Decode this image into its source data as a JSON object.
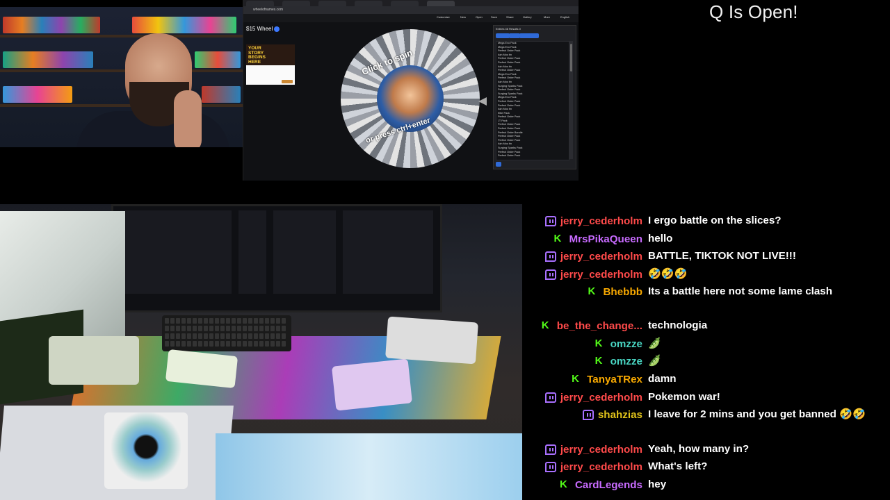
{
  "overlay": {
    "queue_status": "Q Is Open!"
  },
  "browser": {
    "url": "wheelofnames.com",
    "nav": [
      "Customize",
      "New",
      "Open",
      "Save",
      "Share",
      "Gallery",
      "More",
      "English"
    ],
    "wheel_title": "$15 Wheel",
    "ad_title": "YOUR STORY BEGINS HERE",
    "wheel_text_top": "Click to spin",
    "wheel_text_bottom": "or press ctrl+enter",
    "entries_tabs": "Entries 46   Results 0",
    "entries": [
      "Mega Evo Pack",
      "Mega Evo Pack",
      "Perfect Order Pack",
      "Ash Moo  tin",
      "Perfect Order Pack",
      "Perfect Order Pack",
      "Ash Moo  tin",
      "Perfect Order Pack",
      "Mega Evo Pack",
      "Perfect Order Pack",
      "Ash Moo  tin",
      "Surging Sparks Pack",
      "Perfect Order Pack",
      "Surging Sparks Pack",
      "Mega Evo Pack",
      "Perfect Order Pack",
      "Perfect Order Pack",
      "Ash Moo  tin",
      "Elite Pack",
      "Perfect Order Pack",
      "JT Pack",
      "Perfect Order Pack",
      "Perfect Order Pack",
      "Perfect Order Bundle",
      "Perfect Order Pack",
      "Perfect Order Pack",
      "Ash Moo  tin",
      "Surging Sparks Pack",
      "Perfect Order Pack",
      "Perfect Order Pack"
    ]
  },
  "chat": {
    "colors": {
      "kick": "#53fc18",
      "twitch": "#a970ff"
    },
    "messages": [
      {
        "platform": "twitch",
        "user": "jerry_cederholm",
        "color": "#ff4a4a",
        "text": "I ergo battle on the slices?"
      },
      {
        "platform": "kick",
        "user": "MrsPikaQueen",
        "color": "#c86bff",
        "text": "hello"
      },
      {
        "platform": "twitch",
        "user": "jerry_cederholm",
        "color": "#ff4a4a",
        "text": "BATTLE, TIKTOK NOT LIVE!!!"
      },
      {
        "platform": "twitch",
        "user": "jerry_cederholm",
        "color": "#ff4a4a",
        "text": "🤣🤣🤣"
      },
      {
        "platform": "kick",
        "user": "Bhebbb",
        "color": "#f7a800",
        "text": "Its a battle here not some lame clash"
      },
      {
        "platform": "kick",
        "user": "be_the_change...",
        "color": "#ff4a4a",
        "text": "technologia"
      },
      {
        "platform": "kick",
        "user": "omzze",
        "color": "#49d6c3",
        "text": "🫛"
      },
      {
        "platform": "kick",
        "user": "omzze",
        "color": "#49d6c3",
        "text": "🫛"
      },
      {
        "platform": "kick",
        "user": "TanyaTRex",
        "color": "#f7a800",
        "text": "damn"
      },
      {
        "platform": "twitch",
        "user": "jerry_cederholm",
        "color": "#ff4a4a",
        "text": "Pokemon war!"
      },
      {
        "platform": "twitch",
        "user": "shahzias",
        "color": "#e0c21a",
        "text": "I leave for 2 mins and you get banned 🤣🤣"
      },
      {
        "platform": "twitch",
        "user": "jerry_cederholm",
        "color": "#ff4a4a",
        "text": "Yeah, how many in?"
      },
      {
        "platform": "twitch",
        "user": "jerry_cederholm",
        "color": "#ff4a4a",
        "text": "What's left?"
      },
      {
        "platform": "kick",
        "user": "CardLegends",
        "color": "#c86bff",
        "text": "hey"
      }
    ]
  }
}
